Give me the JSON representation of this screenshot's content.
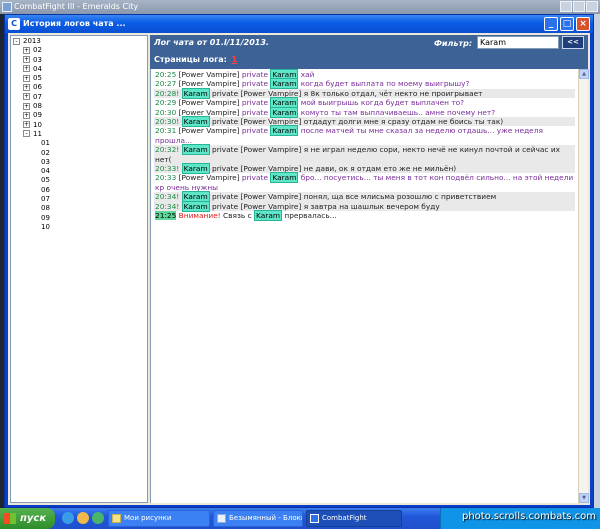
{
  "outer_window": {
    "title": "CombatFight III - Emeralds City"
  },
  "window": {
    "title": "История логов чата ..."
  },
  "tree": {
    "nodes": [
      {
        "label": "2013",
        "level": 0,
        "toggle": "-"
      },
      {
        "label": "02",
        "level": 1,
        "toggle": "+"
      },
      {
        "label": "03",
        "level": 1,
        "toggle": "+"
      },
      {
        "label": "04",
        "level": 1,
        "toggle": "+"
      },
      {
        "label": "05",
        "level": 1,
        "toggle": "+"
      },
      {
        "label": "06",
        "level": 1,
        "toggle": "+"
      },
      {
        "label": "07",
        "level": 1,
        "toggle": "+"
      },
      {
        "label": "08",
        "level": 1,
        "toggle": "+"
      },
      {
        "label": "09",
        "level": 1,
        "toggle": "+"
      },
      {
        "label": "10",
        "level": 1,
        "toggle": "+"
      },
      {
        "label": "11",
        "level": 1,
        "toggle": "-"
      },
      {
        "label": "01",
        "level": 2,
        "toggle": ""
      },
      {
        "label": "02",
        "level": 2,
        "toggle": ""
      },
      {
        "label": "03",
        "level": 2,
        "toggle": ""
      },
      {
        "label": "04",
        "level": 2,
        "toggle": ""
      },
      {
        "label": "05",
        "level": 2,
        "toggle": ""
      },
      {
        "label": "06",
        "level": 2,
        "toggle": ""
      },
      {
        "label": "07",
        "level": 2,
        "toggle": ""
      },
      {
        "label": "08",
        "level": 2,
        "toggle": ""
      },
      {
        "label": "09",
        "level": 2,
        "toggle": ""
      },
      {
        "label": "10",
        "level": 2,
        "toggle": ""
      }
    ]
  },
  "header": {
    "log_title": "Лог чата от 01.l/11/2013.",
    "filter_label": "Фильтр:",
    "filter_value": "Karam",
    "filter_button": "<<",
    "pages_label": "Страницы лога:",
    "page_number": "1"
  },
  "messages": [
    {
      "time": "20:25",
      "from": "[Power Vampire]",
      "mode": "private",
      "to": "Karam",
      "to_tagged": true,
      "text": "хай",
      "style": "private"
    },
    {
      "time": "20:27",
      "from": "[Power Vampire]",
      "mode": "private",
      "to": "Karam",
      "to_tagged": true,
      "text": "когда будет выплата по моему выигрышу?",
      "style": "private"
    },
    {
      "time": "20:28!",
      "from": "Karam",
      "from_tagged": true,
      "mode": "private",
      "to": "[Power Vampire]",
      "text": "я 8к только отдал, чёт некто не проигрывает",
      "style": "plain"
    },
    {
      "time": "20:29",
      "from": "[Power Vampire]",
      "mode": "private",
      "to": "Karam",
      "to_tagged": true,
      "text": "мой выигрышь когда будет выплачен то?",
      "style": "private"
    },
    {
      "time": "20:30",
      "from": "[Power Vampire]",
      "mode": "private",
      "to": "Karam",
      "to_tagged": true,
      "text": "комуто ты там выплачиваешь.. амне почему нет?",
      "style": "private"
    },
    {
      "time": "20:30!",
      "from": "Karam",
      "from_tagged": true,
      "mode": "private",
      "to": "[Power Vampire]",
      "text": "отдадут долги мне я сразу отдам не боись ты так)",
      "style": "plain"
    },
    {
      "time": "20:31",
      "from": "[Power Vampire]",
      "mode": "private",
      "to": "Karam",
      "to_tagged": true,
      "text": "после матчей ты мне сказал за неделю отдашь... уже неделя прошла...",
      "style": "private"
    },
    {
      "time": "20:32!",
      "from": "Karam",
      "from_tagged": true,
      "mode": "private",
      "to": "[Power Vampire]",
      "text": "я не играл неделю сори, некто нечё не кинул почтой и сейчас их нет(",
      "style": "plain"
    },
    {
      "time": "20:33!",
      "from": "Karam",
      "from_tagged": true,
      "mode": "private",
      "to": "[Power Vampire]",
      "text": "не дави, ок я отдам ето же не мильён)",
      "style": "plain"
    },
    {
      "time": "20:33",
      "from": "[Power Vampire]",
      "mode": "private",
      "to": "Karam",
      "to_tagged": true,
      "text": "бро... посуетись... ты меня в тот кон подвёл сильно... на этой недели кр очень нужны",
      "style": "private"
    },
    {
      "time": "20:34!",
      "from": "Karam",
      "from_tagged": true,
      "mode": "private",
      "to": "[Power Vampire]",
      "text": "понял, ща все млисьма розошлю с приветствием",
      "style": "plain"
    },
    {
      "time": "20:34!",
      "from": "Karam",
      "from_tagged": true,
      "mode": "private",
      "to": "[Power Vampire]",
      "text": "я завтра на шашлык вечером буду",
      "style": "plain"
    }
  ],
  "system_message": {
    "time": "21:25",
    "warning": "Внимание!",
    "before": "Связь с",
    "nick": "Karam",
    "after": "прервалась..."
  },
  "taskbar": {
    "start_label": "пуск",
    "tasks": [
      {
        "label": "Мои рисунки"
      },
      {
        "label": "Безымянный - Блокнот"
      },
      {
        "label": "CombatFight"
      }
    ],
    "watermark": "photo.scrolls.combats.com"
  },
  "colors": {
    "title_bar": "#0b5ee6",
    "header_bg": "#3d6396",
    "private_text": "#7a2d9a",
    "nick_highlight": "#5fe6c9",
    "time": "#1f8a4a",
    "warning": "#e01919"
  }
}
